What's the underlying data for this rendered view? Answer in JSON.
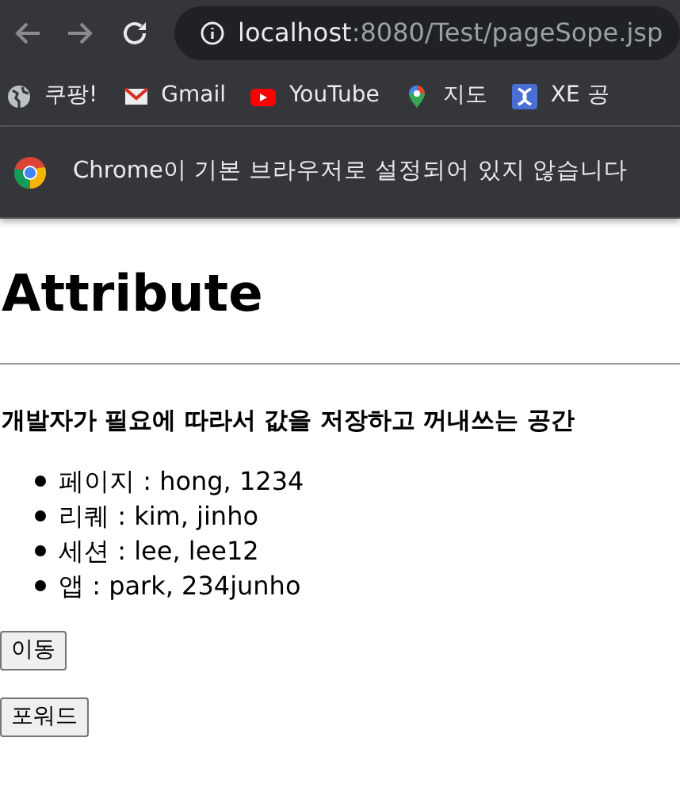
{
  "browser": {
    "url_host": "localhost",
    "url_path": ":8080/Test/pageSope.jsp",
    "bookmarks": [
      {
        "label": "쿠팡!",
        "kind": "globe"
      },
      {
        "label": "Gmail",
        "kind": "mail"
      },
      {
        "label": "YouTube",
        "kind": "play"
      },
      {
        "label": "지도",
        "kind": "pin"
      },
      {
        "label": "XE 공",
        "kind": "xe"
      }
    ],
    "infobar": "Chrome이 기본 브라우저로 설정되어 있지 않습니다"
  },
  "page": {
    "heading": "Attribute",
    "subtitle": "개발자가 필요에 따라서 값을 저장하고 꺼내쓰는 공간",
    "items": [
      "페이지 : hong, 1234",
      "리퀘 : kim, jinho",
      "세션 : lee, lee12",
      "앱 : park, 234junho"
    ],
    "buttons": [
      "이동",
      "포워드"
    ]
  }
}
